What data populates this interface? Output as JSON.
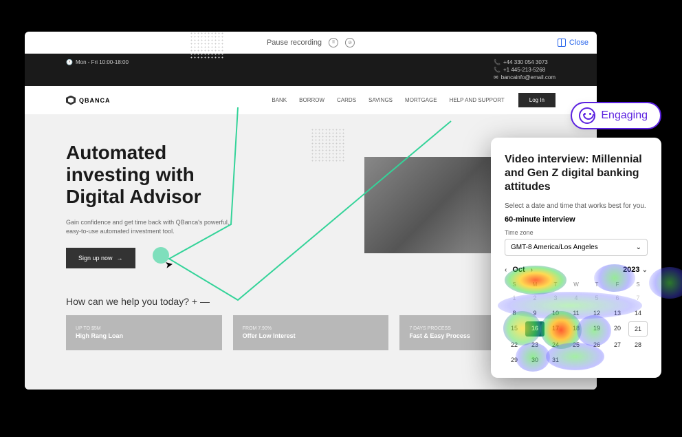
{
  "toolbar": {
    "pause_label": "Pause recording",
    "close_label": "Close"
  },
  "site": {
    "top_bar": {
      "hours": "Mon - Fri 10:00-18:00",
      "phone1": "+44 330 054 3073",
      "phone2": "+1 445-213-5268",
      "email": "bancainfo@email.com"
    },
    "brand": "QBANCA",
    "nav": [
      "BANK",
      "BORROW",
      "CARDS",
      "SAVINGS",
      "MORTGAGE",
      "HELP AND SUPPORT"
    ],
    "login_label": "Log In",
    "hero": {
      "title_line1": "Automated",
      "title_line2": "investing with",
      "title_line3": "Digital Advisor",
      "desc": "Gain confidence and get time back with QBanca's powerful, easy-to-use automated investment tool.",
      "cta": "Sign up now"
    },
    "section_title": "How can we help you today? + —",
    "cards": [
      {
        "eyebrow": "UP TO $5M",
        "title": "High Rang Loan"
      },
      {
        "eyebrow": "FROM 7.90%",
        "title": "Offer Low Interest"
      },
      {
        "eyebrow": "7 DAYS PROCESS",
        "title": "Fast & Easy Process"
      }
    ]
  },
  "engaging_pill": {
    "label": "Engaging"
  },
  "modal": {
    "title": "Video interview: Millennial and Gen Z digital banking attitudes",
    "subtext": "Select a date and time that works best for you.",
    "duration": "60-minute interview",
    "tz_label": "Time zone",
    "tz_value": "GMT-8 America/Los Angeles",
    "month": "Oct",
    "year": "2023",
    "weekdays": [
      "S",
      "M",
      "T",
      "W",
      "T",
      "F",
      "S"
    ],
    "days": [
      {
        "n": "1",
        "muted": true
      },
      {
        "n": "2",
        "muted": true
      },
      {
        "n": "3",
        "muted": true
      },
      {
        "n": "4",
        "muted": true
      },
      {
        "n": "5",
        "muted": true
      },
      {
        "n": "6",
        "muted": true
      },
      {
        "n": "7",
        "muted": true
      },
      {
        "n": "8"
      },
      {
        "n": "9"
      },
      {
        "n": "10"
      },
      {
        "n": "11"
      },
      {
        "n": "12"
      },
      {
        "n": "13"
      },
      {
        "n": "14"
      },
      {
        "n": "15"
      },
      {
        "n": "16",
        "selected": true
      },
      {
        "n": "17"
      },
      {
        "n": "18"
      },
      {
        "n": "19"
      },
      {
        "n": "20"
      },
      {
        "n": "21",
        "outlined": true
      },
      {
        "n": "22"
      },
      {
        "n": "23"
      },
      {
        "n": "24"
      },
      {
        "n": "25"
      },
      {
        "n": "26"
      },
      {
        "n": "27"
      },
      {
        "n": "28"
      },
      {
        "n": "29"
      },
      {
        "n": "30"
      },
      {
        "n": "31"
      }
    ]
  },
  "chart_data": {
    "type": "heatmap",
    "description": "Click/attention heatmap overlaid on calendar widget",
    "hotspots": [
      {
        "area": "month-label-oct",
        "intensity": 0.95
      },
      {
        "area": "month-nav-arrows",
        "intensity": 0.85
      },
      {
        "area": "year-2023",
        "intensity": 0.6
      },
      {
        "area": "day-10",
        "intensity": 0.9
      },
      {
        "area": "day-9",
        "intensity": 0.75
      },
      {
        "area": "day-8",
        "intensity": 0.5
      },
      {
        "area": "day-11",
        "intensity": 0.7
      },
      {
        "area": "day-16-selected",
        "intensity": 0.6
      },
      {
        "area": "day-17-18",
        "intensity": 0.5
      },
      {
        "area": "weekday-row",
        "intensity": 0.4
      }
    ]
  }
}
